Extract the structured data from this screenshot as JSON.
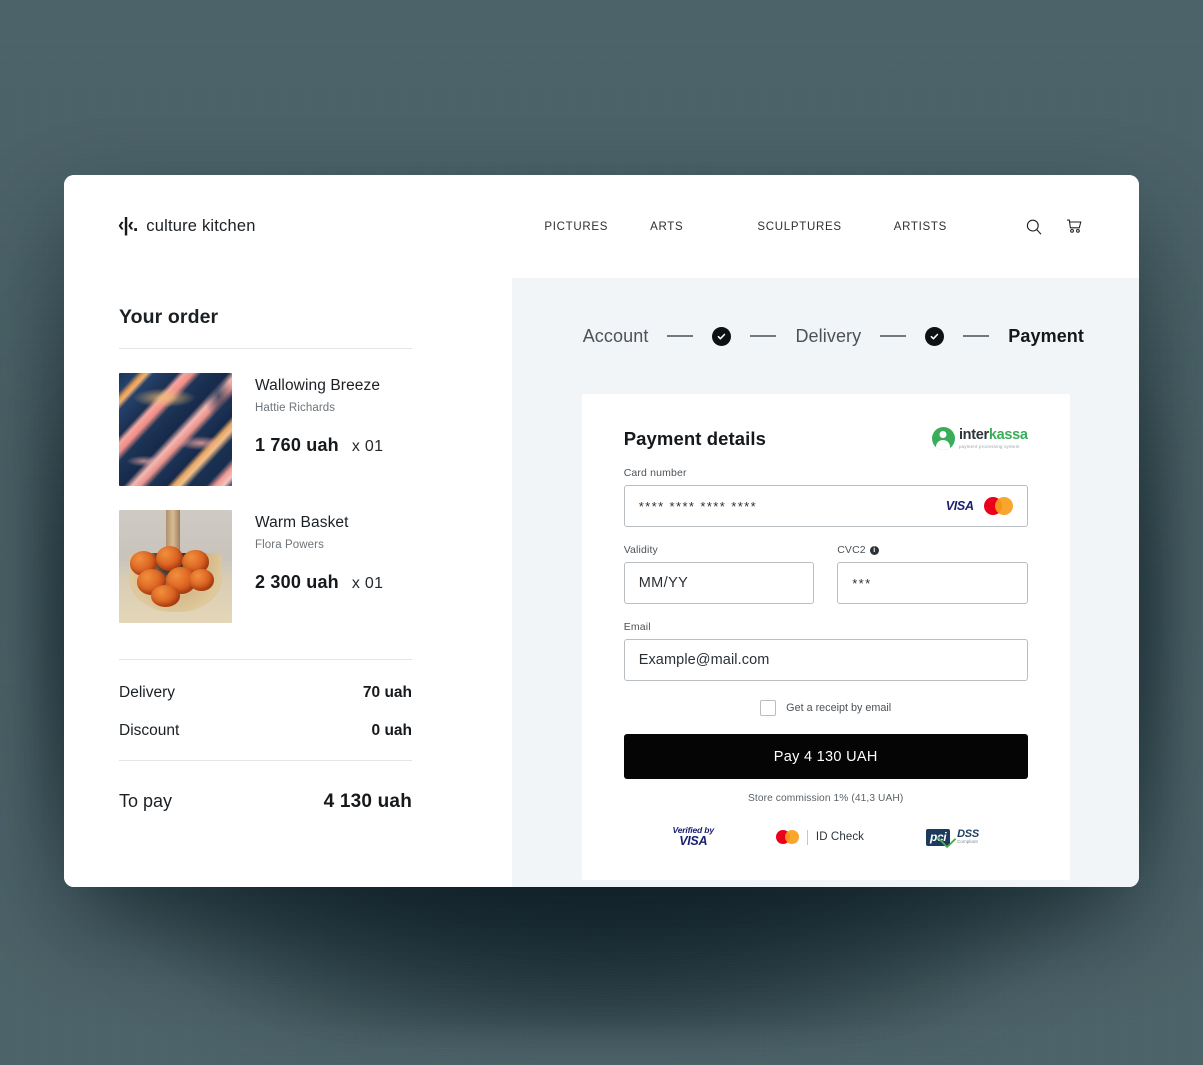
{
  "brand": {
    "mark": "‹|‹.",
    "name": "culture kitchen"
  },
  "nav": {
    "items": [
      {
        "label": "PICTURES"
      },
      {
        "label": "ARTS"
      },
      {
        "label": "SCULPTURES"
      },
      {
        "label": "ARTISTS"
      }
    ],
    "search_icon": "search-icon",
    "cart_icon": "cart-icon"
  },
  "order": {
    "title": "Your order",
    "items": [
      {
        "title": "Wallowing Breeze",
        "author": "Hattie Richards",
        "price": "1 760 uah",
        "qty": "x 01",
        "art": "abstract-fluid-art-navy-pink"
      },
      {
        "title": "Warm Basket",
        "author": "Flora Powers",
        "price": "2 300 uah",
        "qty": "x 01",
        "art": "still-life-persimmons-bowl"
      }
    ],
    "totals": [
      {
        "label": "Delivery",
        "value": "70 uah"
      },
      {
        "label": "Discount",
        "value": "0 uah"
      }
    ],
    "grand": {
      "label": "To pay",
      "value": "4 130 uah"
    }
  },
  "stepper": {
    "steps": [
      {
        "label": "Account",
        "state": "done"
      },
      {
        "label": "Delivery",
        "state": "done"
      },
      {
        "label": "Payment",
        "state": "active"
      }
    ]
  },
  "payment": {
    "title": "Payment details",
    "provider": {
      "name_part1": "inter",
      "name_part2": "kassa",
      "tagline": "payment processing system"
    },
    "card_number": {
      "label": "Card number",
      "placeholder": "**** **** **** ****",
      "brands": [
        "VISA",
        "mastercard"
      ]
    },
    "validity": {
      "label": "Validity",
      "placeholder": "MM/YY"
    },
    "cvc": {
      "label": "CVC2",
      "placeholder": "***",
      "info_icon": "info-icon"
    },
    "email": {
      "label": "Email",
      "placeholder": "Example@mail.com"
    },
    "receipt_checkbox": {
      "label": "Get a receipt by email",
      "checked": false
    },
    "pay_button": "Pay 4 130 UAH",
    "commission": "Store commission  1% (41,3 UAH)",
    "trust": {
      "visa_verified_top": "Verified by",
      "visa_verified_main": "VISA",
      "idcheck_label": "ID Check",
      "pci_tag": "pci",
      "pci_dss": "DSS",
      "pci_sub": "Compliant"
    }
  },
  "colors": {
    "page_background": "#4a656b",
    "card_background": "#ffffff",
    "checkout_background": "#f1f5f8",
    "accent_dark": "#050505",
    "provider_green": "#3aad5b",
    "visa_blue": "#1a1f71",
    "mc_red": "#eb001b",
    "mc_orange": "#f79e1b"
  }
}
